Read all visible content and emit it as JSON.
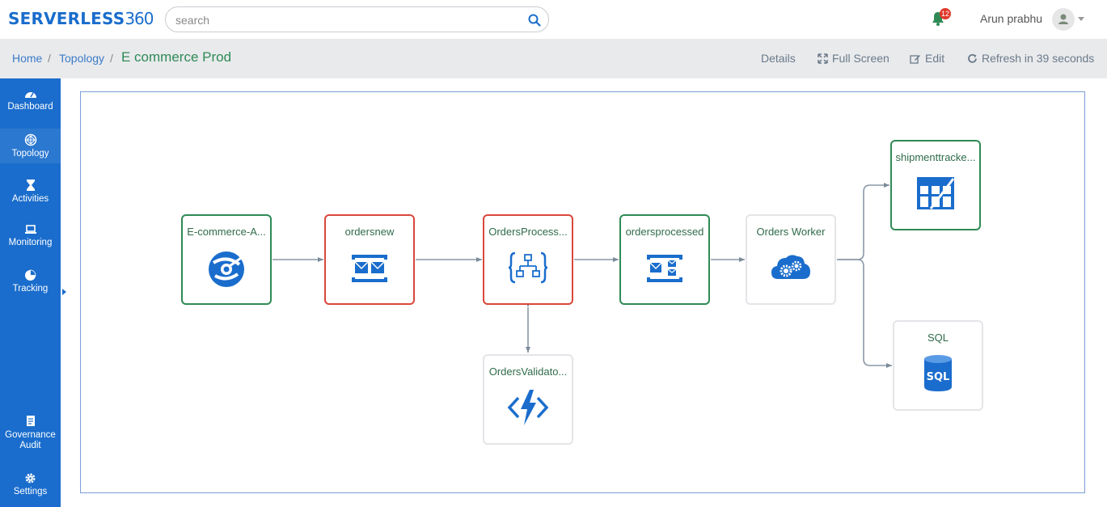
{
  "header": {
    "logo_text": "SERVERLESS",
    "logo_num": "360",
    "search": {
      "placeholder": "search",
      "value": ""
    },
    "notifications_count": "12",
    "user_name": "Arun prabhu"
  },
  "breadcrumb": {
    "home": "Home",
    "topology": "Topology",
    "current": "E commerce Prod"
  },
  "actions": {
    "details": "Details",
    "full_screen": "Full Screen",
    "edit": "Edit",
    "refresh": "Refresh in 39 seconds"
  },
  "sidebar": {
    "items": [
      {
        "label": "Dashboard",
        "icon": "dashboard-icon"
      },
      {
        "label": "Topology",
        "icon": "topology-icon"
      },
      {
        "label": "Activities",
        "icon": "hourglass-icon"
      },
      {
        "label": "Monitoring",
        "icon": "laptop-icon"
      },
      {
        "label": "Tracking",
        "icon": "pie-icon"
      }
    ],
    "bottom_items": [
      {
        "label_line1": "Governance",
        "label_line2": "Audit",
        "icon": "document-icon"
      },
      {
        "label": "Settings",
        "icon": "gear-icon"
      }
    ]
  },
  "topology": {
    "nodes": [
      {
        "id": "ecommerce-api",
        "label": "E-commerce-A...",
        "status": "healthy",
        "icon": "api-management-icon"
      },
      {
        "id": "ordersnew",
        "label": "ordersnew",
        "status": "error",
        "icon": "service-bus-queue-icon"
      },
      {
        "id": "orders-process",
        "label": "OrdersProcess...",
        "status": "error",
        "icon": "logic-app-icon"
      },
      {
        "id": "ordersprocessed",
        "label": "ordersprocessed",
        "status": "healthy",
        "icon": "service-bus-topic-icon"
      },
      {
        "id": "orders-worker",
        "label": "Orders Worker",
        "status": "unmonitored",
        "icon": "cloud-service-icon"
      },
      {
        "id": "shipment-tracker",
        "label": "shipmenttracke...",
        "status": "healthy",
        "icon": "table-storage-icon"
      },
      {
        "id": "sql",
        "label": "SQL",
        "status": "unmonitored",
        "icon": "sql-database-icon"
      },
      {
        "id": "orders-validator",
        "label": "OrdersValidato...",
        "status": "unmonitored",
        "icon": "function-app-icon"
      }
    ],
    "colors": {
      "healthy": "#2f8a55",
      "error": "#d9473b",
      "unmonitored": "#e3e5e8",
      "icon_blue": "#1a6dcc"
    }
  }
}
